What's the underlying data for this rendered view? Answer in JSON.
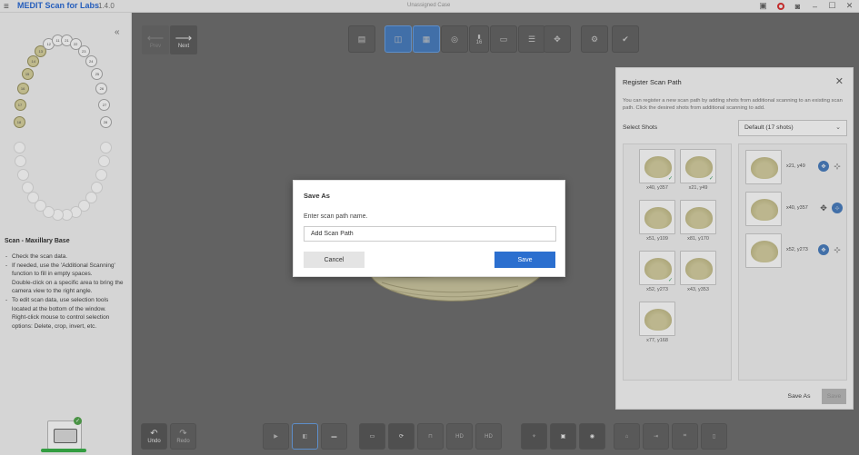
{
  "titlebar": {
    "menu_icon": "hamburger-icon",
    "app_name": "MEDIT Scan for Labs",
    "version": "1.4.0",
    "case_name": "Unassigned Case"
  },
  "nav": {
    "prev_label": "Prev",
    "next_label": "Next"
  },
  "left_panel": {
    "step_title": "Scan - Maxillary Base",
    "instructions": [
      "Check the scan data.",
      "If needed, use the 'Additional Scanning' function to fill in empty spaces.",
      "Double-click on a specific area to bring the camera view to the right angle.",
      "To edit scan data, use selection tools located at the bottom of the window.",
      "Right-click mouse to control selection options: Delete, crop, invert, etc."
    ]
  },
  "toolbar": {
    "tooth_count": "16"
  },
  "bottombar": {
    "undo_label": "Undo",
    "redo_label": "Redo",
    "hd1_label": "HD",
    "hd2_label": "HD"
  },
  "register_panel": {
    "title": "Register Scan Path",
    "description": "You can register a new scan path by adding shots from additional scanning to an existing scan path. Click the desired shots from additional scanning to add.",
    "select_shots_label": "Select Shots",
    "dropdown_value": "Default (17 shots)",
    "shots": [
      {
        "label": "x40, y357",
        "checked": true
      },
      {
        "label": "x21, y49",
        "checked": true
      },
      {
        "label": "x51, y109",
        "checked": false
      },
      {
        "label": "x81, y170",
        "checked": false
      },
      {
        "label": "x52, y273",
        "checked": true
      },
      {
        "label": "x43, y353",
        "checked": false
      },
      {
        "label": "x77, y168",
        "checked": false
      }
    ],
    "selected": [
      {
        "label": "x21, y49"
      },
      {
        "label": "x40, y357"
      },
      {
        "label": "x52, y273"
      }
    ],
    "save_as_label": "Save As",
    "save_label": "Save"
  },
  "modal": {
    "title": "Save As",
    "prompt": "Enter scan path name.",
    "input_value": "Add Scan Path",
    "cancel_label": "Cancel",
    "save_label": "Save"
  },
  "colors": {
    "accent": "#2b6fcf",
    "scanned_tooth": "#d9d3a0",
    "check_green": "#3fa46a"
  }
}
